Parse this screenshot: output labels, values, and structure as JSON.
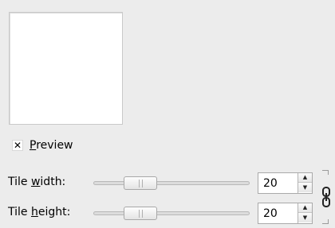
{
  "preview": {
    "label_mnemonic": "P",
    "label_rest": "review",
    "checked_mark": "✕",
    "checked": true
  },
  "tile_width": {
    "label_prefix": "Tile ",
    "label_mnemonic": "w",
    "label_rest": "idth:",
    "value": "20"
  },
  "tile_height": {
    "label_prefix": "Tile ",
    "label_mnemonic": "h",
    "label_rest": "eight:",
    "value": "20"
  },
  "chain": {
    "icon": "chain-link-icon",
    "linked": true
  }
}
